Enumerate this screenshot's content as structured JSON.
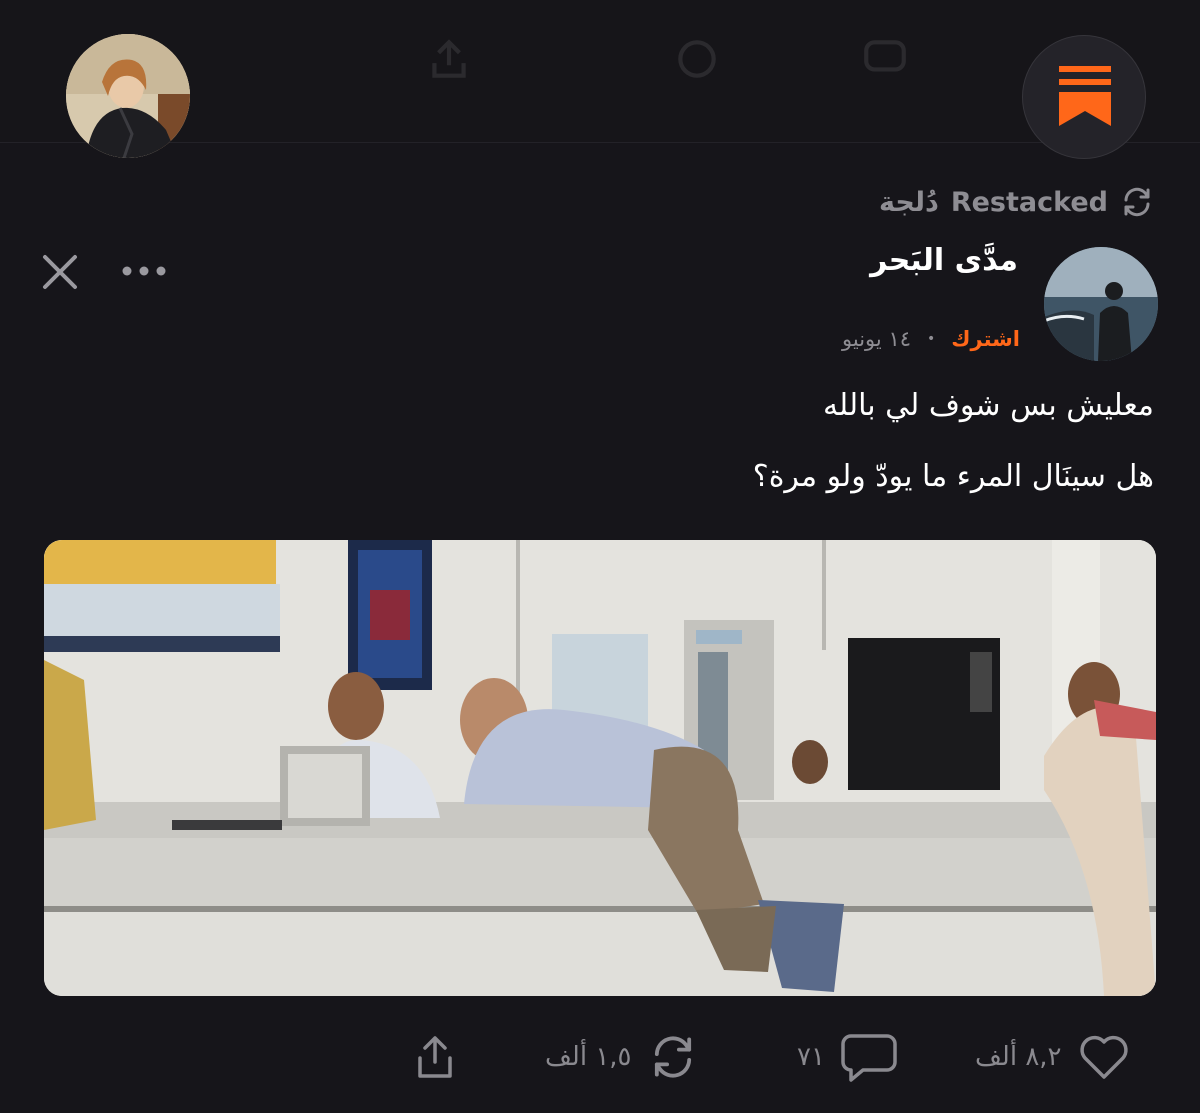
{
  "colors": {
    "background": "#16151a",
    "accent": "#ff6719",
    "muted_text": "#8e8d93",
    "icon_gray": "#8a898f"
  },
  "header": {
    "user_avatar_icon": "profile-photo",
    "app_logo_icon": "substack-logo"
  },
  "restack": {
    "icon": "restack-icon",
    "label": "Restacked",
    "by": "دُلجة"
  },
  "post": {
    "author_name": "مدَّى البَحر",
    "date": "١٤ يونيو",
    "subscribe_label": "اشترك",
    "text_line_1": "معليش بس شوف لي بالله",
    "text_line_2": "هل سينَال المرء ما يودّ ولو مرة؟"
  },
  "actions": {
    "likes": "٨,٢ ألف",
    "comments": "٧١",
    "restacks": "١,٥ ألف",
    "share_icon": "share-icon"
  }
}
